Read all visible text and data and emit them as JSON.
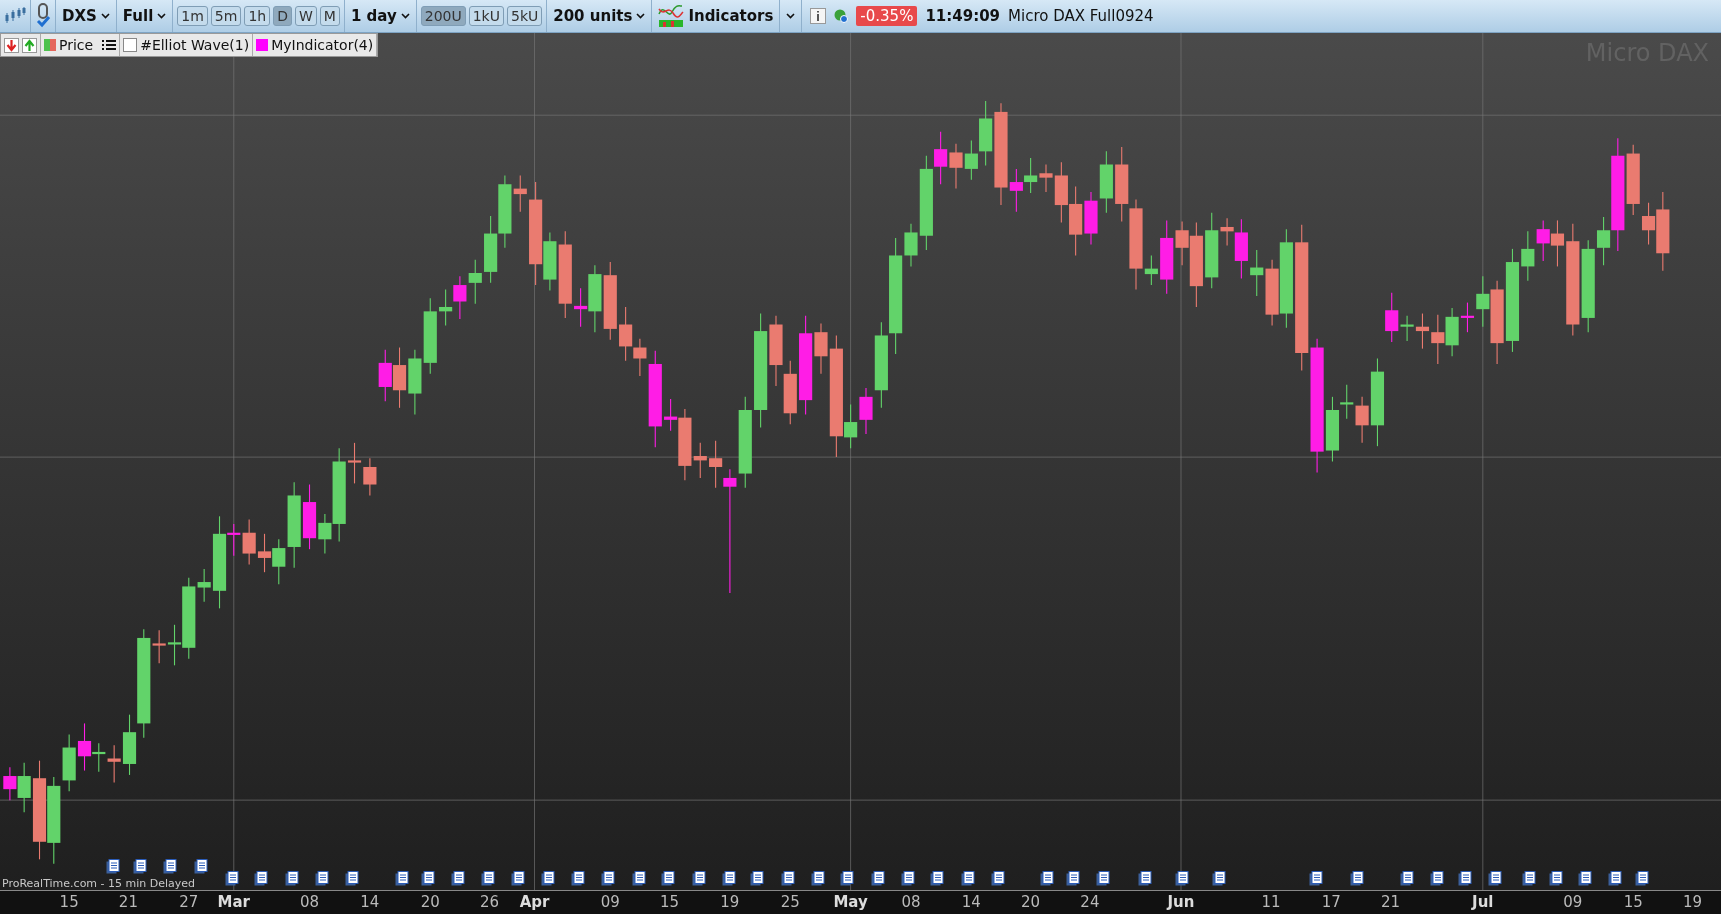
{
  "toolbar": {
    "symbol": "DXS",
    "view": "Full",
    "timeframes": [
      {
        "label": "1m",
        "selected": false
      },
      {
        "label": "5m",
        "selected": false
      },
      {
        "label": "1h",
        "selected": false
      },
      {
        "label": "D",
        "selected": true
      },
      {
        "label": "W",
        "selected": false
      },
      {
        "label": "M",
        "selected": false
      }
    ],
    "period": "1 day",
    "units_buttons": [
      {
        "label": "200U",
        "selected": true
      },
      {
        "label": "1kU",
        "selected": false
      },
      {
        "label": "5kU",
        "selected": false
      }
    ],
    "units": "200 units",
    "indicators": "Indicators",
    "change": "-0.35%",
    "time": "11:49:09",
    "instrument": "Micro DAX Full0924"
  },
  "legend": [
    {
      "kind": "price",
      "label": "Price"
    },
    {
      "kind": "checkbox",
      "label": "#Elliot Wave(1)",
      "checked": false
    },
    {
      "kind": "swatch",
      "label": "MyIndicator(4)",
      "color": "#ff00ff"
    }
  ],
  "chart": {
    "watermark": "Micro DAX",
    "source": "ProRealTime.com - 15 min Delayed"
  },
  "x_axis": [
    {
      "label": "15",
      "kind": "day"
    },
    {
      "label": "21",
      "kind": "day"
    },
    {
      "label": "27",
      "kind": "day"
    },
    {
      "label": "Mar",
      "kind": "month"
    },
    {
      "label": "08",
      "kind": "day"
    },
    {
      "label": "14",
      "kind": "day"
    },
    {
      "label": "20",
      "kind": "day"
    },
    {
      "label": "26",
      "kind": "day"
    },
    {
      "label": "Apr",
      "kind": "month"
    },
    {
      "label": "09",
      "kind": "day"
    },
    {
      "label": "15",
      "kind": "day"
    },
    {
      "label": "19",
      "kind": "day"
    },
    {
      "label": "25",
      "kind": "day"
    },
    {
      "label": "May",
      "kind": "month"
    },
    {
      "label": "08",
      "kind": "day"
    },
    {
      "label": "14",
      "kind": "day"
    },
    {
      "label": "20",
      "kind": "day"
    },
    {
      "label": "24",
      "kind": "day"
    },
    {
      "label": "Jun",
      "kind": "month"
    },
    {
      "label": "11",
      "kind": "day"
    },
    {
      "label": "17",
      "kind": "day"
    },
    {
      "label": "21",
      "kind": "day"
    },
    {
      "label": "Jul",
      "kind": "month"
    },
    {
      "label": "09",
      "kind": "day"
    },
    {
      "label": "15",
      "kind": "day"
    },
    {
      "label": "19",
      "kind": "day"
    }
  ]
}
